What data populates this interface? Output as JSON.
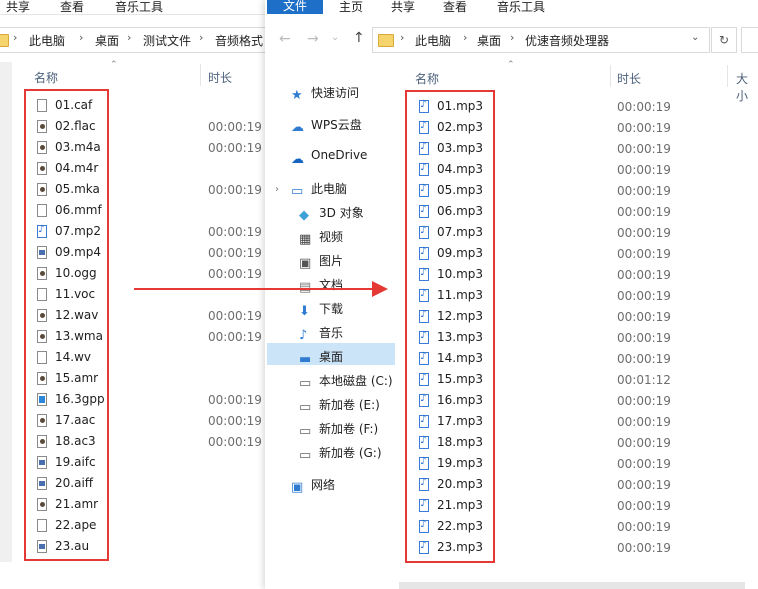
{
  "left_window": {
    "ribbon_tabs": [
      "共享",
      "查看",
      "音乐工具"
    ],
    "breadcrumb": [
      "此电脑",
      "桌面",
      "测试文件",
      "音频格式"
    ],
    "columns": {
      "name": "名称",
      "time": "时长"
    },
    "files": [
      {
        "name": "01.caf",
        "time": "",
        "icon": "blank-file-icon"
      },
      {
        "name": "02.flac",
        "time": "00:00:19",
        "icon": "media-file-icon"
      },
      {
        "name": "03.m4a",
        "time": "00:00:19",
        "icon": "media-file-icon"
      },
      {
        "name": "04.m4r",
        "time": "",
        "icon": "media-file-icon"
      },
      {
        "name": "05.mka",
        "time": "00:00:19",
        "icon": "media-file-icon"
      },
      {
        "name": "06.mmf",
        "time": "",
        "icon": "blank-file-icon"
      },
      {
        "name": "07.mp2",
        "time": "00:00:19",
        "icon": "audio-file-icon"
      },
      {
        "name": "09.mp4",
        "time": "00:00:19",
        "icon": "video-file-icon"
      },
      {
        "name": "10.ogg",
        "time": "00:00:19",
        "icon": "media-file-icon"
      },
      {
        "name": "11.voc",
        "time": "",
        "icon": "blank-file-icon"
      },
      {
        "name": "12.wav",
        "time": "00:00:19",
        "icon": "media-file-icon"
      },
      {
        "name": "13.wma",
        "time": "00:00:19",
        "icon": "media-file-icon"
      },
      {
        "name": "14.wv",
        "time": "",
        "icon": "blank-file-icon"
      },
      {
        "name": "15.amr",
        "time": "",
        "icon": "media-file-icon"
      },
      {
        "name": "16.3gpp",
        "time": "00:00:19",
        "icon": "3gpp-file-icon"
      },
      {
        "name": "17.aac",
        "time": "00:00:19",
        "icon": "media-file-icon"
      },
      {
        "name": "18.ac3",
        "time": "00:00:19",
        "icon": "media-file-icon"
      },
      {
        "name": "19.aifc",
        "time": "",
        "icon": "video-file-icon"
      },
      {
        "name": "20.aiff",
        "time": "",
        "icon": "video-file-icon"
      },
      {
        "name": "21.amr",
        "time": "",
        "icon": "media-file-icon"
      },
      {
        "name": "22.ape",
        "time": "",
        "icon": "blank-file-icon"
      },
      {
        "name": "23.au",
        "time": "",
        "icon": "video-file-icon"
      }
    ]
  },
  "right_window": {
    "ribbon_tabs": [
      "文件",
      "主页",
      "共享",
      "查看",
      "音乐工具"
    ],
    "breadcrumb": [
      "此电脑",
      "桌面",
      "优速音频处理器"
    ],
    "columns": {
      "name": "名称",
      "time": "时长",
      "size": "大小"
    },
    "nav": [
      {
        "label": "快速访问",
        "icon": "star-icon"
      },
      {
        "label": "WPS云盘",
        "icon": "cloud-icon"
      },
      {
        "label": "OneDrive",
        "icon": "onedrive-icon"
      },
      {
        "label": "此电脑",
        "icon": "computer-icon"
      },
      {
        "label": "3D 对象",
        "icon": "cube-icon"
      },
      {
        "label": "视频",
        "icon": "video-icon"
      },
      {
        "label": "图片",
        "icon": "picture-icon"
      },
      {
        "label": "文档",
        "icon": "document-icon"
      },
      {
        "label": "下载",
        "icon": "download-icon"
      },
      {
        "label": "音乐",
        "icon": "music-icon"
      },
      {
        "label": "桌面",
        "icon": "desktop-icon"
      },
      {
        "label": "本地磁盘 (C:)",
        "icon": "drive-icon"
      },
      {
        "label": "新加卷 (E:)",
        "icon": "drive-icon"
      },
      {
        "label": "新加卷 (F:)",
        "icon": "drive-icon"
      },
      {
        "label": "新加卷 (G:)",
        "icon": "drive-icon"
      },
      {
        "label": "网络",
        "icon": "network-icon"
      }
    ],
    "files": [
      {
        "name": "01.mp3",
        "time": "00:00:19"
      },
      {
        "name": "02.mp3",
        "time": "00:00:19"
      },
      {
        "name": "03.mp3",
        "time": "00:00:19"
      },
      {
        "name": "04.mp3",
        "time": "00:00:19"
      },
      {
        "name": "05.mp3",
        "time": "00:00:19"
      },
      {
        "name": "06.mp3",
        "time": "00:00:19"
      },
      {
        "name": "07.mp3",
        "time": "00:00:19"
      },
      {
        "name": "09.mp3",
        "time": "00:00:19"
      },
      {
        "name": "10.mp3",
        "time": "00:00:19"
      },
      {
        "name": "11.mp3",
        "time": "00:00:19"
      },
      {
        "name": "12.mp3",
        "time": "00:00:19"
      },
      {
        "name": "13.mp3",
        "time": "00:00:19"
      },
      {
        "name": "14.mp3",
        "time": "00:00:19"
      },
      {
        "name": "15.mp3",
        "time": "00:01:12"
      },
      {
        "name": "16.mp3",
        "time": "00:00:19"
      },
      {
        "name": "17.mp3",
        "time": "00:00:19"
      },
      {
        "name": "18.mp3",
        "time": "00:00:19"
      },
      {
        "name": "19.mp3",
        "time": "00:00:19"
      },
      {
        "name": "20.mp3",
        "time": "00:00:19"
      },
      {
        "name": "21.mp3",
        "time": "00:00:19"
      },
      {
        "name": "22.mp3",
        "time": "00:00:19"
      },
      {
        "name": "23.mp3",
        "time": "00:00:19"
      }
    ]
  },
  "colors": {
    "highlight_red": "#e53935",
    "file_tab_blue": "#1e6fc8",
    "nav_selected": "#cce4f7"
  }
}
